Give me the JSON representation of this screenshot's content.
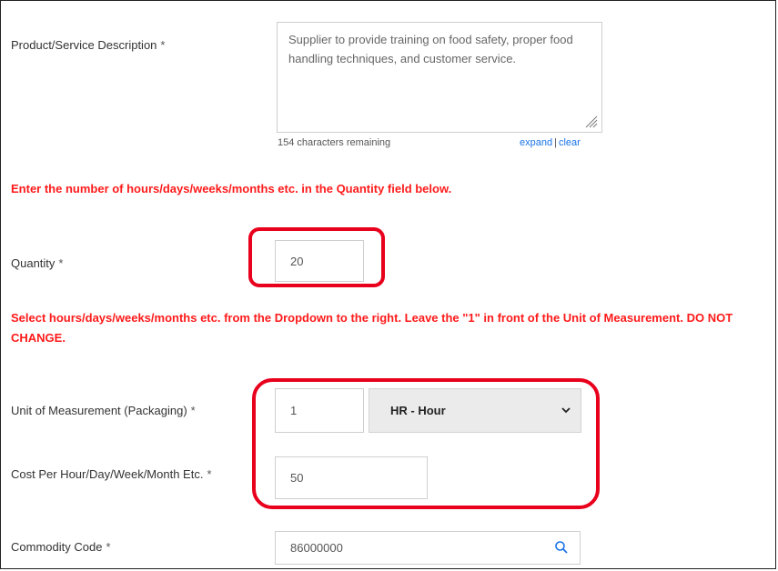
{
  "description": {
    "label": "Product/Service Description",
    "required": "*",
    "value": "Supplier to provide training on food safety, proper food handling techniques, and customer service.",
    "chars_remaining": "154 characters remaining",
    "expand": "expand",
    "separator": "|",
    "clear": "clear"
  },
  "instruction_quantity": "Enter the number of hours/days/weeks/months etc. in the Quantity field below.",
  "quantity": {
    "label": "Quantity",
    "required": "*",
    "value": "20"
  },
  "instruction_uom": "Select hours/days/weeks/months etc. from the Dropdown to the right. Leave the \"1\" in front of the Unit of Measurement. DO NOT CHANGE.",
  "uom": {
    "label": "Unit of Measurement (Packaging)",
    "required": "*",
    "qty_value": "1",
    "selected": "HR - Hour"
  },
  "cost": {
    "label": "Cost Per Hour/Day/Week/Month Etc.",
    "required": "*",
    "value": "50"
  },
  "commodity": {
    "label": "Commodity Code",
    "required": "*",
    "value": "86000000"
  },
  "colors": {
    "warning": "#ff1a1a",
    "highlight": "#e8001c",
    "link": "#1a73e8"
  },
  "icons": [
    "search-icon",
    "chevron-down-icon",
    "resize-handle-icon"
  ]
}
